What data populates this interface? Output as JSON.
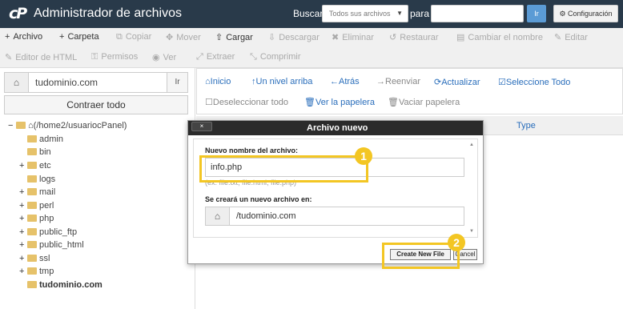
{
  "header": {
    "logo": "cP",
    "title": "Administrador de archivos",
    "search_label": "Buscar",
    "search_scope": "Todos sus archivos",
    "para_label": "para",
    "go_label": "Ir",
    "config_label": "Configuración"
  },
  "toolbar": {
    "row1": [
      {
        "label": "Archivo",
        "icon": "+",
        "disabled": false
      },
      {
        "label": "Carpeta",
        "icon": "+",
        "disabled": false
      },
      {
        "label": "Copiar",
        "icon": "⧉",
        "disabled": true
      },
      {
        "label": "Mover",
        "icon": "✥",
        "disabled": true
      },
      {
        "label": "Cargar",
        "icon": "⇧",
        "disabled": false
      },
      {
        "label": "Descargar",
        "icon": "⇩",
        "disabled": true
      },
      {
        "label": "Eliminar",
        "icon": "✖",
        "disabled": true
      },
      {
        "label": "Restaurar",
        "icon": "↺",
        "disabled": true
      },
      {
        "label": "Cambiar el nombre",
        "icon": "▤",
        "disabled": true
      },
      {
        "label": "Editar",
        "icon": "✎",
        "disabled": true
      }
    ],
    "row2": [
      {
        "label": "Editor de HTML",
        "icon": "✎",
        "disabled": true
      },
      {
        "label": "Permisos",
        "icon": "⚿",
        "disabled": true
      },
      {
        "label": "Ver",
        "icon": "◉",
        "disabled": true
      },
      {
        "label": "Extraer",
        "icon": "⤢",
        "disabled": true
      },
      {
        "label": "Comprimir",
        "icon": "⤡",
        "disabled": true
      }
    ]
  },
  "left": {
    "address": "tudominio.com",
    "address_go": "Ir",
    "collapse_label": "Contraer todo",
    "tree": [
      {
        "label": "(/home2/usuariocPanel)",
        "expand": "−",
        "root": true
      },
      {
        "label": "admin",
        "expand": ""
      },
      {
        "label": "bin",
        "expand": ""
      },
      {
        "label": "etc",
        "expand": "+"
      },
      {
        "label": "logs",
        "expand": ""
      },
      {
        "label": "mail",
        "expand": "+"
      },
      {
        "label": "perl",
        "expand": "+"
      },
      {
        "label": "php",
        "expand": "+"
      },
      {
        "label": "public_ftp",
        "expand": "+"
      },
      {
        "label": "public_html",
        "expand": "+"
      },
      {
        "label": "ssl",
        "expand": "+"
      },
      {
        "label": "tmp",
        "expand": "+"
      },
      {
        "label": "tudominio.com",
        "expand": "",
        "active": true
      }
    ]
  },
  "nav": {
    "row1": [
      {
        "label": "Inicio",
        "icon": "⌂"
      },
      {
        "label": "Un nivel arriba",
        "icon": "↑"
      },
      {
        "label": "Atrás",
        "icon": "←"
      },
      {
        "label": "Reenviar",
        "icon": "→",
        "disabled": true
      },
      {
        "label": "Actualizar",
        "icon": "⟳"
      },
      {
        "label": "Seleccione Todo",
        "icon": "☑"
      }
    ],
    "row2": [
      {
        "label": "Deseleccionar todo",
        "icon": "☐",
        "disabled": true
      },
      {
        "label": "Ver la papelera",
        "icon": "🗑"
      },
      {
        "label": "Vaciar papelera",
        "icon": "🗑",
        "disabled": true
      }
    ]
  },
  "table": {
    "col_type": "Type"
  },
  "modal": {
    "close_label": "×",
    "title": "Archivo nuevo",
    "name_label": "Nuevo nombre del archivo:",
    "name_value": "info.php",
    "name_hint": "(ex: file.txt, file.html, file.php)",
    "path_label": "Se creará un nuevo archivo en:",
    "path_value": "/tudominio.com",
    "create_label": "Create New File",
    "cancel_label": "Cancel"
  },
  "annotations": {
    "badge1": "1",
    "badge2": "2",
    "color": "#f3c623"
  }
}
